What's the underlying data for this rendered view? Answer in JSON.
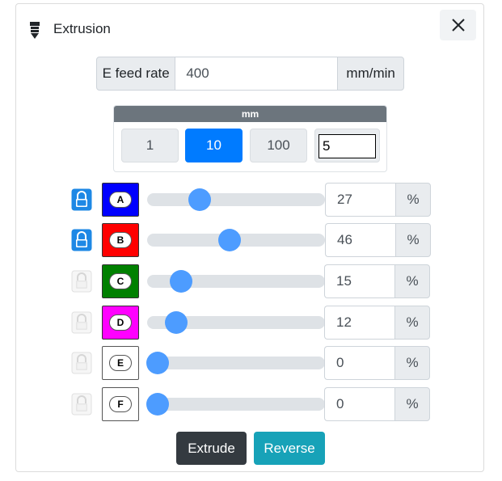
{
  "header": {
    "title": "Extrusion",
    "icon": "extruder-icon",
    "close_icon": "close-icon"
  },
  "feed": {
    "label": "E feed rate",
    "value": "400",
    "unit": "mm/min"
  },
  "mm": {
    "label": "mm",
    "buttons": [
      {
        "label": "1",
        "active": false
      },
      {
        "label": "10",
        "active": true
      },
      {
        "label": "100",
        "active": false
      }
    ],
    "custom_value": "5"
  },
  "channels": [
    {
      "letter": "A",
      "color": "#0000ff",
      "locked": true,
      "value": "27",
      "percent": 27,
      "unit": "%"
    },
    {
      "letter": "B",
      "color": "#ff0000",
      "locked": true,
      "value": "46",
      "percent": 46,
      "unit": "%"
    },
    {
      "letter": "C",
      "color": "#008000",
      "locked": false,
      "value": "15",
      "percent": 15,
      "unit": "%"
    },
    {
      "letter": "D",
      "color": "#ff00ff",
      "locked": false,
      "value": "12",
      "percent": 12,
      "unit": "%"
    },
    {
      "letter": "E",
      "color": "#ffffff",
      "locked": false,
      "value": "0",
      "percent": 0,
      "unit": "%"
    },
    {
      "letter": "F",
      "color": "#ffffff",
      "locked": false,
      "value": "0",
      "percent": 0,
      "unit": "%"
    }
  ],
  "actions": {
    "extrude": "Extrude",
    "reverse": "Reverse"
  },
  "colors": {
    "primary": "#007bff",
    "dark": "#343a40",
    "info": "#17a2b8",
    "lock_active": "#1e88e5",
    "lock_inactive": "#e0e0e0",
    "slider": "#4d9cff"
  }
}
